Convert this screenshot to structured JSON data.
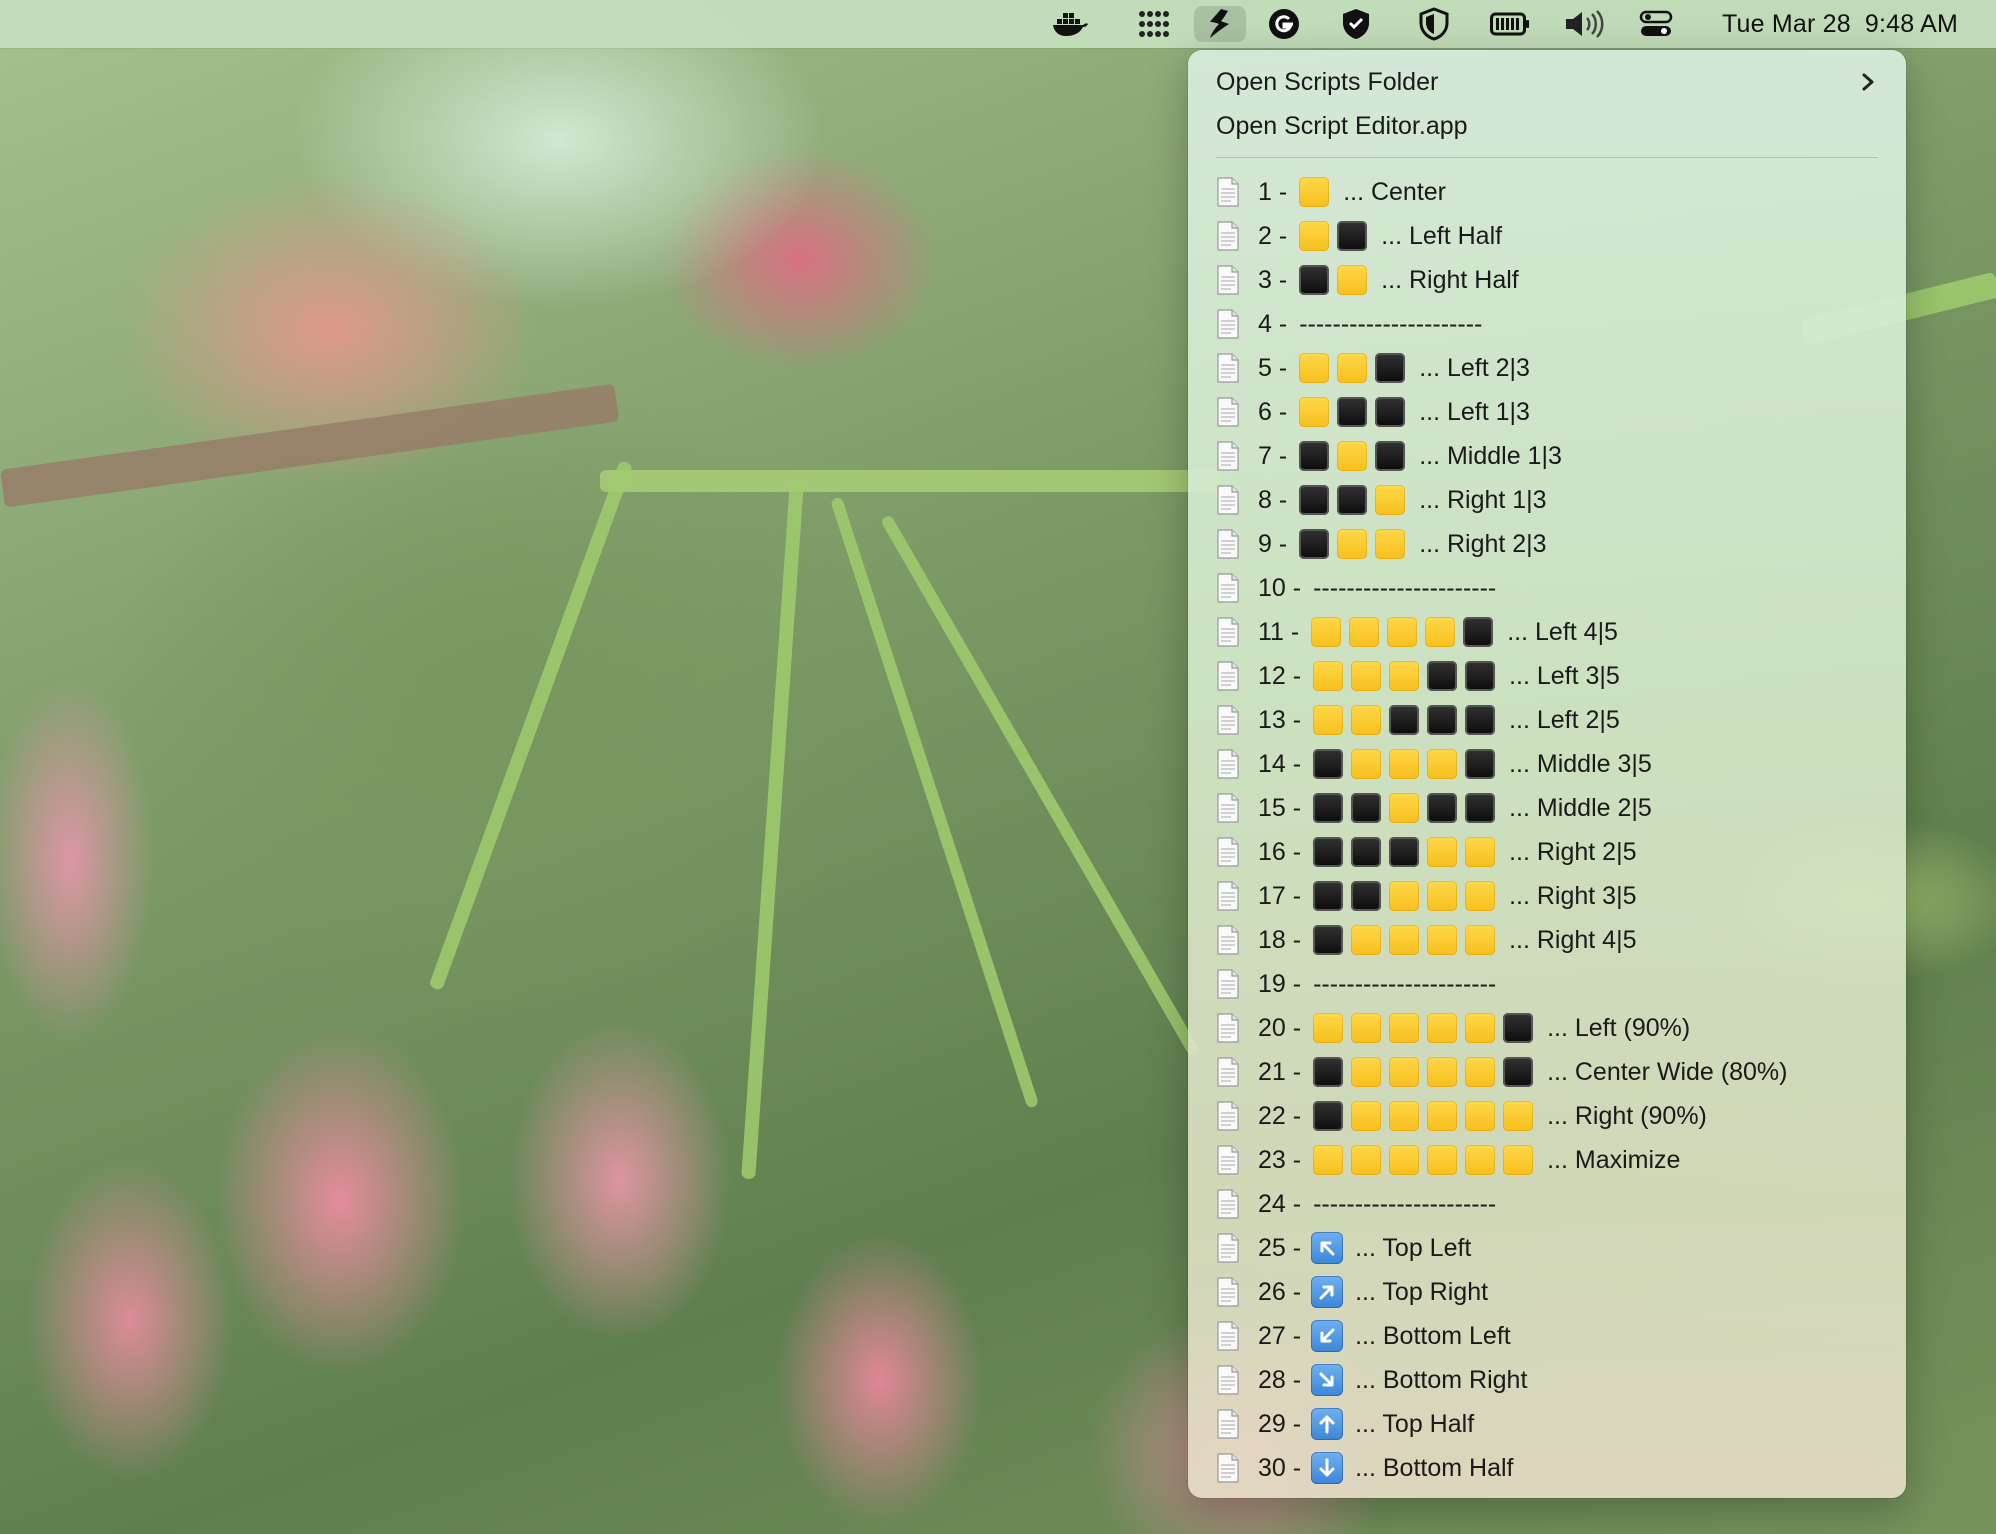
{
  "menubar": {
    "icons": [
      "docker-icon",
      "launchpad-dots-icon",
      "scripts-icon",
      "grammarly-icon",
      "vpn-shield-icon",
      "security-shield-icon",
      "battery-icon",
      "volume-icon",
      "control-center-icon"
    ],
    "active_icon": "scripts-icon",
    "date": "Tue Mar 28",
    "time": "9:48 AM"
  },
  "menu": {
    "open_folder": "Open Scripts Folder",
    "open_editor": "Open Script Editor.app",
    "items": [
      {
        "num": "1 -",
        "squares": "y",
        "label": "... Center"
      },
      {
        "num": "2 -",
        "squares": "yb",
        "label": "... Left Half"
      },
      {
        "num": "3 -",
        "squares": "by",
        "label": "... Right Half"
      },
      {
        "num": "4 -",
        "squares": "",
        "label": "----------------------"
      },
      {
        "num": "5 -",
        "squares": "yyb",
        "label": "... Left 2|3"
      },
      {
        "num": "6 -",
        "squares": "ybb",
        "label": "... Left 1|3"
      },
      {
        "num": "7 -",
        "squares": "byb",
        "label": "... Middle 1|3"
      },
      {
        "num": "8 -",
        "squares": "bby",
        "label": "... Right 1|3"
      },
      {
        "num": "9 -",
        "squares": "byy",
        "label": "... Right 2|3"
      },
      {
        "num": "10 -",
        "squares": "",
        "label": "----------------------"
      },
      {
        "num": "11 -",
        "squares": "yyyyb",
        "label": "... Left 4|5"
      },
      {
        "num": "12 -",
        "squares": "yyybb",
        "label": "... Left 3|5"
      },
      {
        "num": "13 -",
        "squares": "yybbb",
        "label": "... Left 2|5"
      },
      {
        "num": "14 -",
        "squares": "byyyb",
        "label": "... Middle 3|5"
      },
      {
        "num": "15 -",
        "squares": "bbybb",
        "label": "... Middle 2|5"
      },
      {
        "num": "16 -",
        "squares": "bbbyy",
        "label": "... Right 2|5"
      },
      {
        "num": "17 -",
        "squares": "bbyyy",
        "label": "... Right 3|5"
      },
      {
        "num": "18 -",
        "squares": "byyyy",
        "label": "... Right 4|5"
      },
      {
        "num": "19 -",
        "squares": "",
        "label": "----------------------"
      },
      {
        "num": "20 -",
        "squares": "yyyyyb",
        "label": "... Left (90%)"
      },
      {
        "num": "21 -",
        "squares": "byyyyb",
        "label": "... Center Wide (80%)"
      },
      {
        "num": "22 -",
        "squares": "byyyyy",
        "label": "... Right (90%)"
      },
      {
        "num": "23 -",
        "squares": "yyyyyy",
        "label": "... Maximize"
      },
      {
        "num": "24 -",
        "squares": "",
        "label": "----------------------"
      },
      {
        "num": "25 -",
        "arrow": "nw",
        "label": "... Top Left"
      },
      {
        "num": "26 -",
        "arrow": "ne",
        "label": "... Top Right"
      },
      {
        "num": "27 -",
        "arrow": "sw",
        "label": "... Bottom Left"
      },
      {
        "num": "28 -",
        "arrow": "se",
        "label": "... Bottom Right"
      },
      {
        "num": "29 -",
        "arrow": "n",
        "label": "... Top Half"
      },
      {
        "num": "30 -",
        "arrow": "s",
        "label": "... Bottom Half"
      }
    ]
  },
  "colors": {
    "square_on": "#f7bf1d",
    "square_off": "#111111",
    "arrow_bg": "#3c86d8"
  }
}
